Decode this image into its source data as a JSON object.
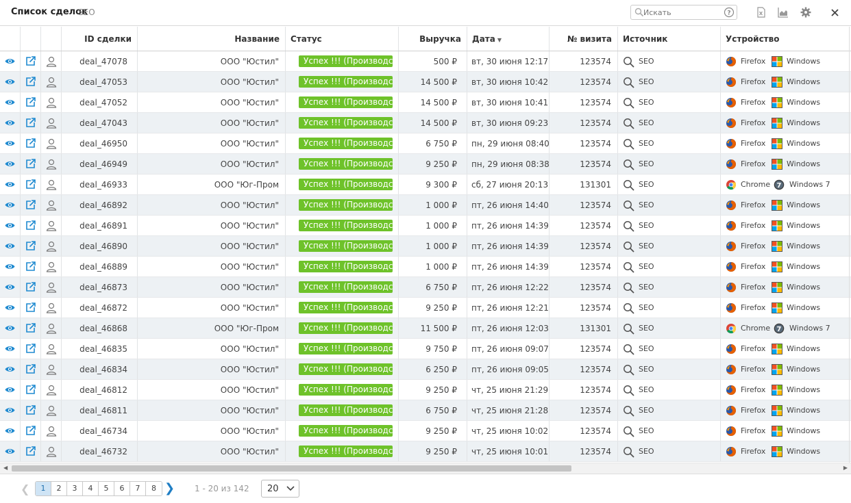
{
  "header": {
    "title": "Список сделок",
    "subtitle": "SEO",
    "search_placeholder": "Искать"
  },
  "colors": {
    "status_green": "#6ec22a",
    "icon_blue": "#1f8ad0",
    "row_alt": "#edf1f4",
    "page_active": "#cfe4f5"
  },
  "columns": {
    "id": "ID сделки",
    "name": "Название",
    "status": "Статус",
    "revenue": "Выручка",
    "date": "Дата",
    "visit": "№ визита",
    "source": "Источник",
    "device": "Устройство"
  },
  "rows": [
    {
      "id": "deal_47078",
      "name": "ООО \"Юстил\"",
      "status": "Успех !!! (Производство)",
      "revenue": "500 ₽",
      "date": "вт, 30 июня 12:17",
      "visit": "123574",
      "source": "SEO",
      "browser": "Firefox",
      "os": "Windows"
    },
    {
      "id": "deal_47053",
      "name": "ООО \"Юстил\"",
      "status": "Успех !!! (Производство)",
      "revenue": "14 500 ₽",
      "date": "вт, 30 июня 10:42",
      "visit": "123574",
      "source": "SEO",
      "browser": "Firefox",
      "os": "Windows"
    },
    {
      "id": "deal_47052",
      "name": "ООО \"Юстил\"",
      "status": "Успех !!! (Производство)",
      "revenue": "14 500 ₽",
      "date": "вт, 30 июня 10:41",
      "visit": "123574",
      "source": "SEO",
      "browser": "Firefox",
      "os": "Windows"
    },
    {
      "id": "deal_47043",
      "name": "ООО \"Юстил\"",
      "status": "Успех !!! (Производство)",
      "revenue": "14 500 ₽",
      "date": "вт, 30 июня 09:23",
      "visit": "123574",
      "source": "SEO",
      "browser": "Firefox",
      "os": "Windows"
    },
    {
      "id": "deal_46950",
      "name": "ООО \"Юстил\"",
      "status": "Успех !!! (Производство)",
      "revenue": "6 750 ₽",
      "date": "пн, 29 июня 08:40",
      "visit": "123574",
      "source": "SEO",
      "browser": "Firefox",
      "os": "Windows"
    },
    {
      "id": "deal_46949",
      "name": "ООО \"Юстил\"",
      "status": "Успех !!! (Производство)",
      "revenue": "9 250 ₽",
      "date": "пн, 29 июня 08:38",
      "visit": "123574",
      "source": "SEO",
      "browser": "Firefox",
      "os": "Windows"
    },
    {
      "id": "deal_46933",
      "name": "ООО \"Юг-Пром",
      "status": "Успех !!! (Производство)",
      "revenue": "9 300 ₽",
      "date": "сб, 27 июня 20:13",
      "visit": "131301",
      "source": "SEO",
      "browser": "Chrome",
      "os": "Windows 7"
    },
    {
      "id": "deal_46892",
      "name": "ООО \"Юстил\"",
      "status": "Успех !!! (Производство)",
      "revenue": "1 000 ₽",
      "date": "пт, 26 июня 14:40",
      "visit": "123574",
      "source": "SEO",
      "browser": "Firefox",
      "os": "Windows"
    },
    {
      "id": "deal_46891",
      "name": "ООО \"Юстил\"",
      "status": "Успех !!! (Производство)",
      "revenue": "1 000 ₽",
      "date": "пт, 26 июня 14:39",
      "visit": "123574",
      "source": "SEO",
      "browser": "Firefox",
      "os": "Windows"
    },
    {
      "id": "deal_46890",
      "name": "ООО \"Юстил\"",
      "status": "Успех !!! (Производство)",
      "revenue": "1 000 ₽",
      "date": "пт, 26 июня 14:39",
      "visit": "123574",
      "source": "SEO",
      "browser": "Firefox",
      "os": "Windows"
    },
    {
      "id": "deal_46889",
      "name": "ООО \"Юстил\"",
      "status": "Успех !!! (Производство)",
      "revenue": "1 000 ₽",
      "date": "пт, 26 июня 14:39",
      "visit": "123574",
      "source": "SEO",
      "browser": "Firefox",
      "os": "Windows"
    },
    {
      "id": "deal_46873",
      "name": "ООО \"Юстил\"",
      "status": "Успех !!! (Производство)",
      "revenue": "6 750 ₽",
      "date": "пт, 26 июня 12:22",
      "visit": "123574",
      "source": "SEO",
      "browser": "Firefox",
      "os": "Windows"
    },
    {
      "id": "deal_46872",
      "name": "ООО \"Юстил\"",
      "status": "Успех !!! (Производство)",
      "revenue": "9 250 ₽",
      "date": "пт, 26 июня 12:21",
      "visit": "123574",
      "source": "SEO",
      "browser": "Firefox",
      "os": "Windows"
    },
    {
      "id": "deal_46868",
      "name": "ООО \"Юг-Пром",
      "status": "Успех !!! (Производство)",
      "revenue": "11 500 ₽",
      "date": "пт, 26 июня 12:03",
      "visit": "131301",
      "source": "SEO",
      "browser": "Chrome",
      "os": "Windows 7"
    },
    {
      "id": "deal_46835",
      "name": "ООО \"Юстил\"",
      "status": "Успех !!! (Производство)",
      "revenue": "9 750 ₽",
      "date": "пт, 26 июня 09:07",
      "visit": "123574",
      "source": "SEO",
      "browser": "Firefox",
      "os": "Windows"
    },
    {
      "id": "deal_46834",
      "name": "ООО \"Юстил\"",
      "status": "Успех !!! (Производство)",
      "revenue": "6 250 ₽",
      "date": "пт, 26 июня 09:05",
      "visit": "123574",
      "source": "SEO",
      "browser": "Firefox",
      "os": "Windows"
    },
    {
      "id": "deal_46812",
      "name": "ООО \"Юстил\"",
      "status": "Успех !!! (Производство)",
      "revenue": "9 250 ₽",
      "date": "чт, 25 июня 21:29",
      "visit": "123574",
      "source": "SEO",
      "browser": "Firefox",
      "os": "Windows"
    },
    {
      "id": "deal_46811",
      "name": "ООО \"Юстил\"",
      "status": "Успех !!! (Производство)",
      "revenue": "6 750 ₽",
      "date": "чт, 25 июня 21:28",
      "visit": "123574",
      "source": "SEO",
      "browser": "Firefox",
      "os": "Windows"
    },
    {
      "id": "deal_46734",
      "name": "ООО \"Юстил\"",
      "status": "Успех !!! (Производство)",
      "revenue": "9 250 ₽",
      "date": "чт, 25 июня 10:02",
      "visit": "123574",
      "source": "SEO",
      "browser": "Firefox",
      "os": "Windows"
    },
    {
      "id": "deal_46732",
      "name": "ООО \"Юстил\"",
      "status": "Успех !!! (Производство)",
      "revenue": "9 250 ₽",
      "date": "чт, 25 июня 10:01",
      "visit": "123574",
      "source": "SEO",
      "browser": "Firefox",
      "os": "Windows"
    }
  ],
  "pager": {
    "pages": [
      "1",
      "2",
      "3",
      "4",
      "5",
      "6",
      "7",
      "8"
    ],
    "active_page": "1",
    "range": "1 - 20 из 142",
    "per_page": "20"
  }
}
